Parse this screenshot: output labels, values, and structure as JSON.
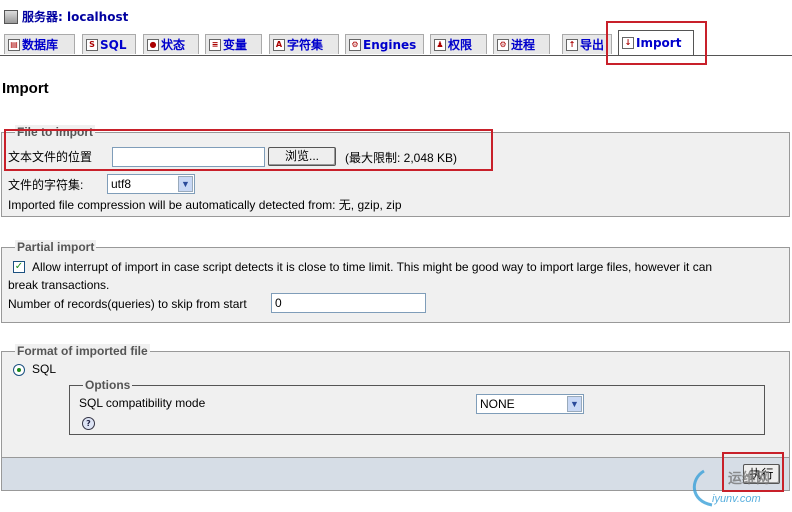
{
  "header": {
    "server_label": "服务器: localhost"
  },
  "tabs": [
    {
      "label": "数据库",
      "icon": "database-icon"
    },
    {
      "label": "SQL",
      "icon": "sql-icon"
    },
    {
      "label": "状态",
      "icon": "status-icon"
    },
    {
      "label": "变量",
      "icon": "variables-icon"
    },
    {
      "label": "字符集",
      "icon": "charset-icon"
    },
    {
      "label": "Engines",
      "icon": "engines-icon"
    },
    {
      "label": "权限",
      "icon": "privileges-icon"
    },
    {
      "label": "进程",
      "icon": "processes-icon"
    },
    {
      "label": "导出",
      "icon": "export-icon"
    },
    {
      "label": "Import",
      "icon": "import-icon"
    }
  ],
  "page_title": "Import",
  "file_section": {
    "legend": "File to import",
    "location_label": "文本文件的位置",
    "file_value": "",
    "browse_label": "浏览...",
    "max_size": "(最大限制: 2,048 KB)",
    "charset_label": "文件的字符集:",
    "charset_value": "utf8",
    "compression_note": "Imported file compression will be automatically detected from: 无, gzip, zip"
  },
  "partial_section": {
    "legend": "Partial import",
    "allow_interrupt_checked": true,
    "allow_interrupt_text_1": "Allow interrupt of import in case script detects it is close to time limit. This might be good way to import large files, however it can",
    "allow_interrupt_text_2": "break transactions.",
    "skip_label": "Number of records(queries) to skip from start",
    "skip_value": "0"
  },
  "format_section": {
    "legend": "Format of imported file",
    "format_option": "SQL",
    "format_selected": true,
    "options_legend": "Options",
    "compat_label": "SQL compatibility mode",
    "compat_value": "NONE"
  },
  "footer": {
    "submit_label": "执行"
  },
  "watermark": {
    "text": "运维网",
    "url_text": "iyunv.com"
  },
  "colors": {
    "highlight_red": "#c8202a",
    "link_blue": "#0000cc",
    "panel_bg": "#f0f0f0",
    "footer_bg": "#d6dde6"
  }
}
